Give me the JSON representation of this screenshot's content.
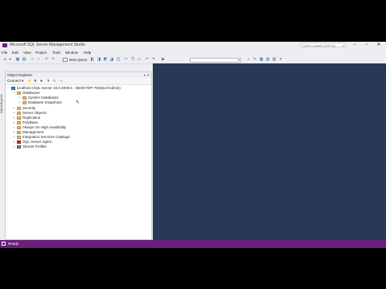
{
  "window": {
    "title": "Microsoft SQL Server Management Studio",
    "quick_launch_placeholder": "Quick Launch (Ctrl+Q)"
  },
  "menu": [
    "File",
    "Edit",
    "View",
    "Project",
    "Tools",
    "Window",
    "Help"
  ],
  "toolbar": {
    "new_query_label": "New Query"
  },
  "left_strip": {
    "label": "Object Explorer"
  },
  "object_explorer": {
    "title": "Object Explorer",
    "header_icons": "▾  ✕",
    "connect_label": "Connect ▾",
    "tree": [
      {
        "label": "localhost (SQL Server 15.0.2000.5 - DESKTOP-7D6QLH\\Admin)",
        "expander": "−",
        "icon": "server"
      },
      {
        "label": "Databases",
        "expander": "−",
        "icon": "folder"
      },
      {
        "label": "System Databases",
        "expander": "+",
        "icon": "folder"
      },
      {
        "label": "Database Snapshots",
        "expander": "+",
        "icon": "folder"
      },
      {
        "label": "Security",
        "expander": "+",
        "icon": "folder"
      },
      {
        "label": "Server Objects",
        "expander": "+",
        "icon": "folder"
      },
      {
        "label": "Replication",
        "expander": "+",
        "icon": "folder"
      },
      {
        "label": "PolyBase",
        "expander": "+",
        "icon": "folder"
      },
      {
        "label": "Always On High Availability",
        "expander": "+",
        "icon": "folder"
      },
      {
        "label": "Management",
        "expander": "+",
        "icon": "folder"
      },
      {
        "label": "Integration Services Catalogs",
        "expander": "+",
        "icon": "folder"
      },
      {
        "label": "SQL Server Agent",
        "expander": "+",
        "icon": "agent"
      },
      {
        "label": "XEvent Profiler",
        "expander": "+",
        "icon": "xe"
      }
    ]
  },
  "status": {
    "text": "Ready"
  },
  "colors": {
    "status_bar": "#68217a",
    "main_area": "#293955",
    "chrome": "#eeeef2"
  }
}
